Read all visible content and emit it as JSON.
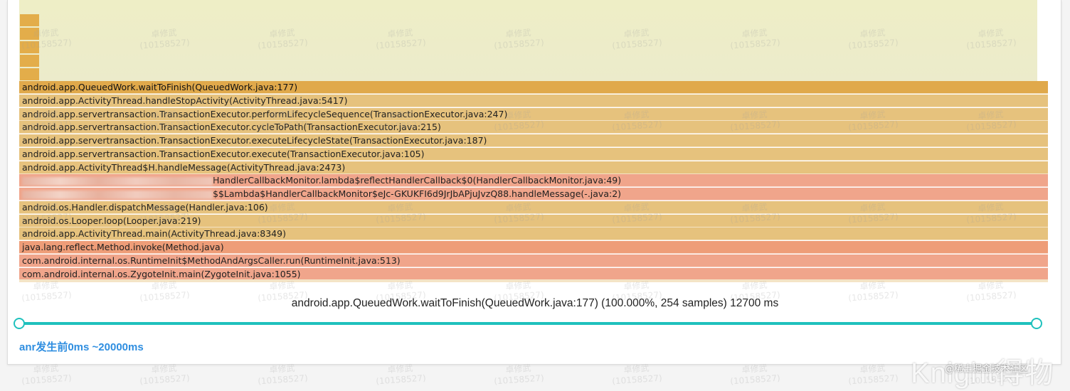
{
  "frames": [
    {
      "label": "android.app.QueuedWork.waitToFinish(QueuedWork.java:177)",
      "style": "hot",
      "blurred": false
    },
    {
      "label": "android.app.ActivityThread.handleStopActivity(ActivityThread.java:5417)",
      "style": "warm",
      "blurred": false
    },
    {
      "label": "android.app.servertransaction.TransactionExecutor.performLifecycleSequence(TransactionExecutor.java:247)",
      "style": "warm",
      "blurred": false
    },
    {
      "label": "android.app.servertransaction.TransactionExecutor.cycleToPath(TransactionExecutor.java:215)",
      "style": "warm",
      "blurred": false
    },
    {
      "label": "android.app.servertransaction.TransactionExecutor.executeLifecycleState(TransactionExecutor.java:187)",
      "style": "warm",
      "blurred": false
    },
    {
      "label": "android.app.servertransaction.TransactionExecutor.execute(TransactionExecutor.java:105)",
      "style": "warm",
      "blurred": false
    },
    {
      "label": "android.app.ActivityThread$H.handleMessage(ActivityThread.java:2473)",
      "style": "warm",
      "blurred": false
    },
    {
      "label": "HandlerCallbackMonitor.lambda$reflectHandlerCallback$0(HandlerCallbackMonitor.java:49)",
      "style": "lightred",
      "blurred": true
    },
    {
      "label": "$$Lambda$HandlerCallbackMonitor$eJc-GKUKFI6d9JrJbAPjuJvzQ88.handleMessage(-.java:2)",
      "style": "lightred",
      "blurred": true
    },
    {
      "label": "android.os.Handler.dispatchMessage(Handler.java:106)",
      "style": "warm",
      "blurred": false
    },
    {
      "label": "android.os.Looper.loop(Looper.java:219)",
      "style": "warm",
      "blurred": false
    },
    {
      "label": "android.app.ActivityThread.main(ActivityThread.java:8349)",
      "style": "warm",
      "blurred": false
    },
    {
      "label": "java.lang.reflect.Method.invoke(Method.java)",
      "style": "red",
      "blurred": false
    },
    {
      "label": "com.android.internal.os.RuntimeInit$MethodAndArgsCaller.run(RuntimeInit.java:513)",
      "style": "lightred",
      "blurred": false
    },
    {
      "label": "com.android.internal.os.ZygoteInit.main(ZygoteInit.java:1055)",
      "style": "lightred",
      "blurred": false
    }
  ],
  "summary": "android.app.QueuedWork.waitToFinish(QueuedWork.java:177) (100.000%, 254 samples) 12700 ms",
  "range_label": "anr发生前0ms ~20000ms",
  "watermark": {
    "name": "卓修武",
    "id": "(10158527)"
  },
  "brand": "Knight得物",
  "credit": "@稀土掘金技术社区",
  "colors": {
    "accent": "#1fc1bd",
    "range_label": "#2f8ee0"
  }
}
